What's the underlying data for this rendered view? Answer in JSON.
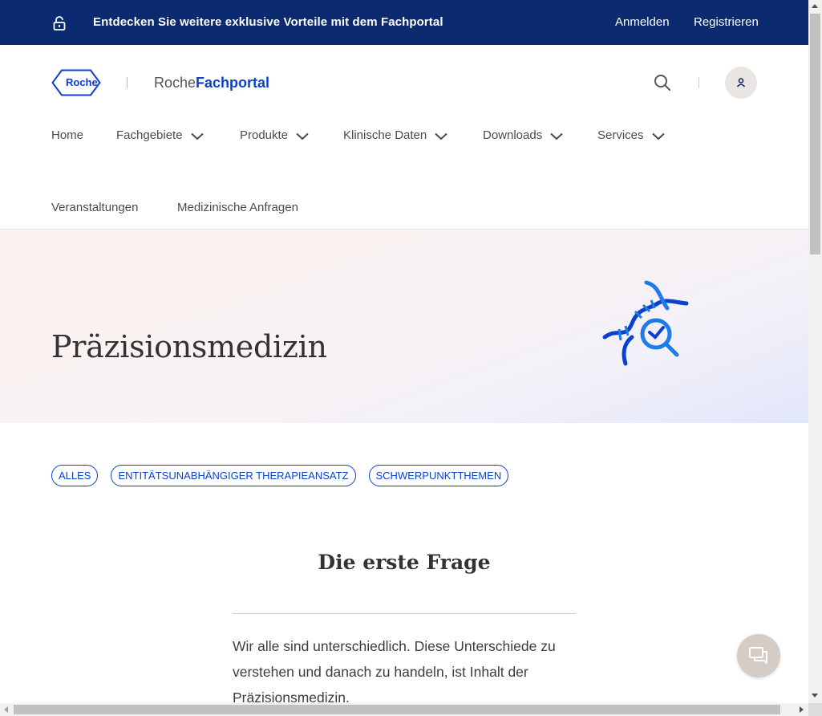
{
  "topbar": {
    "promo": "Entdecken Sie weitere exklusive Vorteile mit dem Fachportal",
    "login": "Anmelden",
    "register": "Registrieren",
    "lock_icon": "unlock-icon"
  },
  "header": {
    "logo_text": "Roche",
    "brand_part1": "Roche",
    "brand_part2": "Fachportal",
    "search_icon": "search-icon",
    "user_icon": "user-icon"
  },
  "nav": {
    "items": [
      {
        "label": "Home",
        "dropdown": false
      },
      {
        "label": "Fachgebiete",
        "dropdown": true
      },
      {
        "label": "Produkte",
        "dropdown": true
      },
      {
        "label": "Klinische Daten",
        "dropdown": true
      },
      {
        "label": "Downloads",
        "dropdown": true
      },
      {
        "label": "Services",
        "dropdown": true
      },
      {
        "label": "Veranstaltungen",
        "dropdown": false
      },
      {
        "label": "Medizinische Anfragen",
        "dropdown": false
      }
    ]
  },
  "hero": {
    "title": "Präzisionsmedizin",
    "icon": "dna-magnifier-icon"
  },
  "filters": {
    "chips": [
      "ALLES",
      "ENTITÄTSUNABHÄNGIGER THERAPIEANSATZ",
      "SCHWERPUNKTTHEMEN"
    ]
  },
  "content": {
    "section_title": "Die erste Frage",
    "body": "Wir alle sind unterschiedlich. Diese Unterschiede zu verstehen und danach zu handeln, ist Inhalt der Präzisionsmedizin."
  },
  "colors": {
    "topbar_bg": "#0b2a6f",
    "accent_blue": "#0b41cd",
    "chat_bg": "#d6ccc6"
  }
}
